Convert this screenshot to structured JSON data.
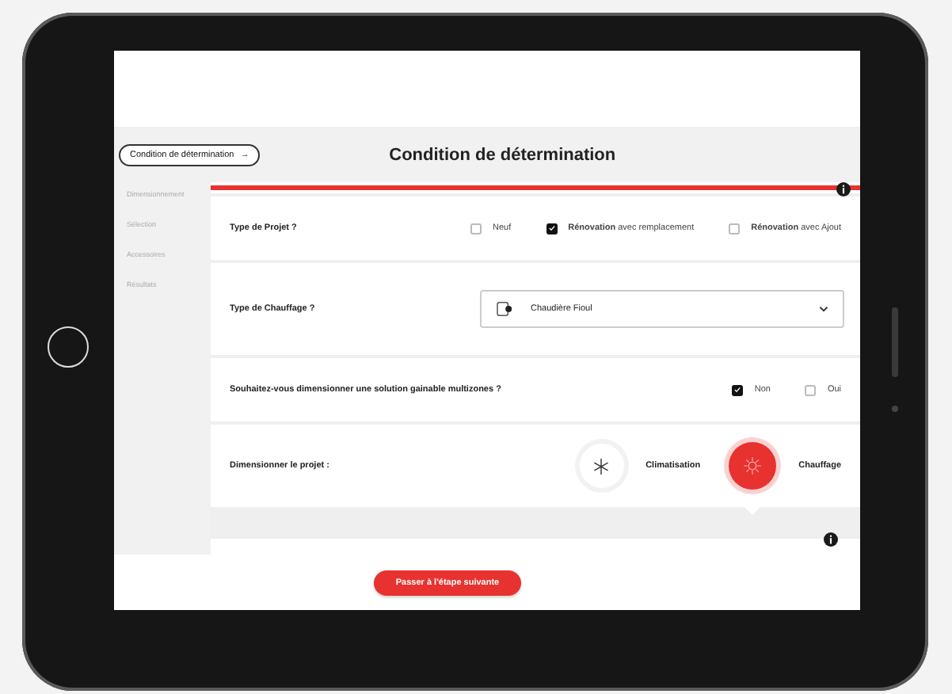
{
  "header": {
    "step_button": "Condition de détermination",
    "step_arrow": "→",
    "title": "Condition de détermination"
  },
  "sidebar": {
    "items": [
      {
        "label": "Dimensionnement",
        "selected": false
      },
      {
        "label": "Sélection",
        "selected": false
      },
      {
        "label": "Accessoires",
        "selected": false
      },
      {
        "label": "Résultats",
        "selected": false
      }
    ]
  },
  "progress": {
    "level": 1
  },
  "questions": [
    {
      "kind": "checkboxes",
      "label": "Type de Projet ?",
      "options": [
        {
          "label": "Neuf",
          "checked": false
        },
        {
          "label": "**Rénovation** avec remplacement",
          "checked": true
        },
        {
          "label": "**Rénovation** avec Ajout",
          "checked": false
        }
      ]
    },
    {
      "kind": "select",
      "label": "Type de Chauffage ?",
      "value": "Chaudière Fioul"
    },
    {
      "kind": "checkboxes",
      "label": "Souhaitez-vous dimensionner une solution gainable multizones ?",
      "options": [
        {
          "label": "Non",
          "checked": true
        },
        {
          "label": "Oui",
          "checked": false
        }
      ]
    },
    {
      "kind": "choice",
      "label": "Dimensionner le projet :",
      "choices": [
        {
          "label": "Climatisation",
          "selected": false
        },
        {
          "label": "Chauffage",
          "selected": true
        }
      ]
    }
  ],
  "next_button": "Passer à l'étape suivante"
}
